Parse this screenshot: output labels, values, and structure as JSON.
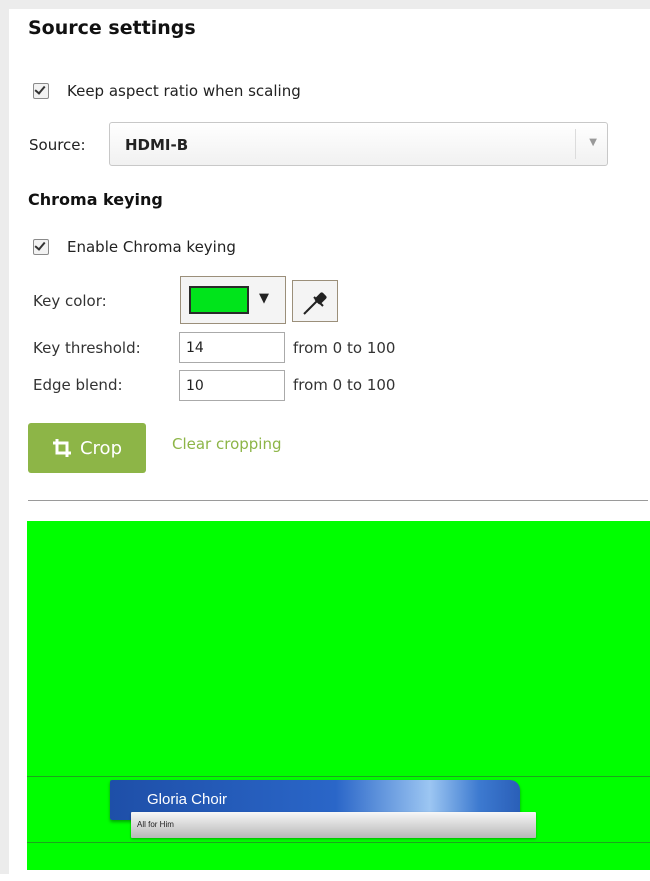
{
  "source_settings": {
    "title": "Source settings",
    "keep_aspect_label": "Keep aspect ratio when scaling",
    "keep_aspect_checked": true,
    "source_label": "Source:",
    "source_value": "HDMI-B"
  },
  "chroma": {
    "title": "Chroma keying",
    "enable_label": "Enable Chroma keying",
    "enable_checked": true,
    "key_color_label": "Key color:",
    "key_color": "#00e41b",
    "threshold_label": "Key threshold:",
    "threshold_value": "14",
    "threshold_range": "from 0 to 100",
    "edge_label": "Edge blend:",
    "edge_value": "10",
    "edge_range": "from 0 to 100"
  },
  "actions": {
    "crop_label": "Crop",
    "clear_label": "Clear cropping"
  },
  "preview": {
    "background": "#00ff00",
    "lower_third_title": "Gloria Choir",
    "lower_third_subtitle": "All for Him"
  },
  "icons": {
    "dropdown": "chevron-down-icon",
    "eyedropper": "eyedropper-icon",
    "crop": "crop-icon"
  },
  "colors": {
    "accent": "#8db547"
  }
}
